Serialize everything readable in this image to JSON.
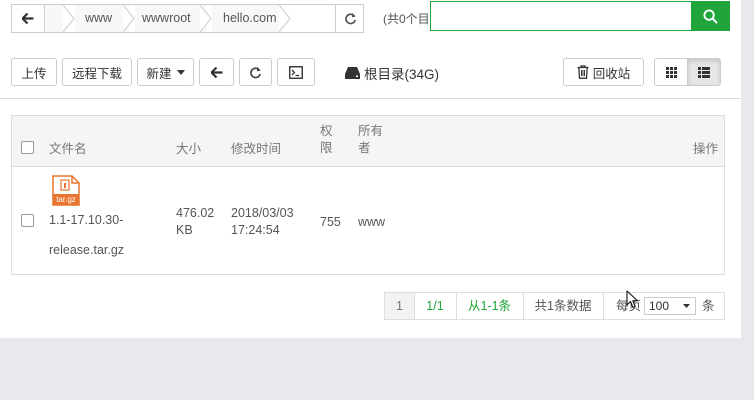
{
  "pathbar": {
    "crumbs": [
      "",
      "www",
      "wwwroot",
      "hello.com",
      ""
    ]
  },
  "search": {
    "count_text": "(共0个目",
    "placeholder": ""
  },
  "toolbar": {
    "upload": "上传",
    "remote_download": "远程下载",
    "new": "新建",
    "disk": "根目录(34G)",
    "recycle": "回收站"
  },
  "table": {
    "headers": {
      "name": "文件名",
      "size": "大小",
      "mtime": "修改时间",
      "perm": "权\n限",
      "owner": "所有\n者",
      "action": "操作"
    },
    "rows": [
      {
        "icon_label": "tar.gz",
        "name_line1": "1.1-17.10.30-",
        "name_line2": "release.tar.gz",
        "size_line1": "476.02",
        "size_line2": "KB",
        "date": "2018/03/03",
        "time": "17:24:54",
        "perm": "755",
        "owner": "www"
      }
    ]
  },
  "pager": {
    "page": "1",
    "pages": "1/1",
    "range": "从1-1条",
    "total": "共1条数据",
    "per_page_label": "每页",
    "per_page_value": "100",
    "unit": "条"
  },
  "colors": {
    "accent": "#20a53a",
    "archive_icon": "#e8742f"
  }
}
